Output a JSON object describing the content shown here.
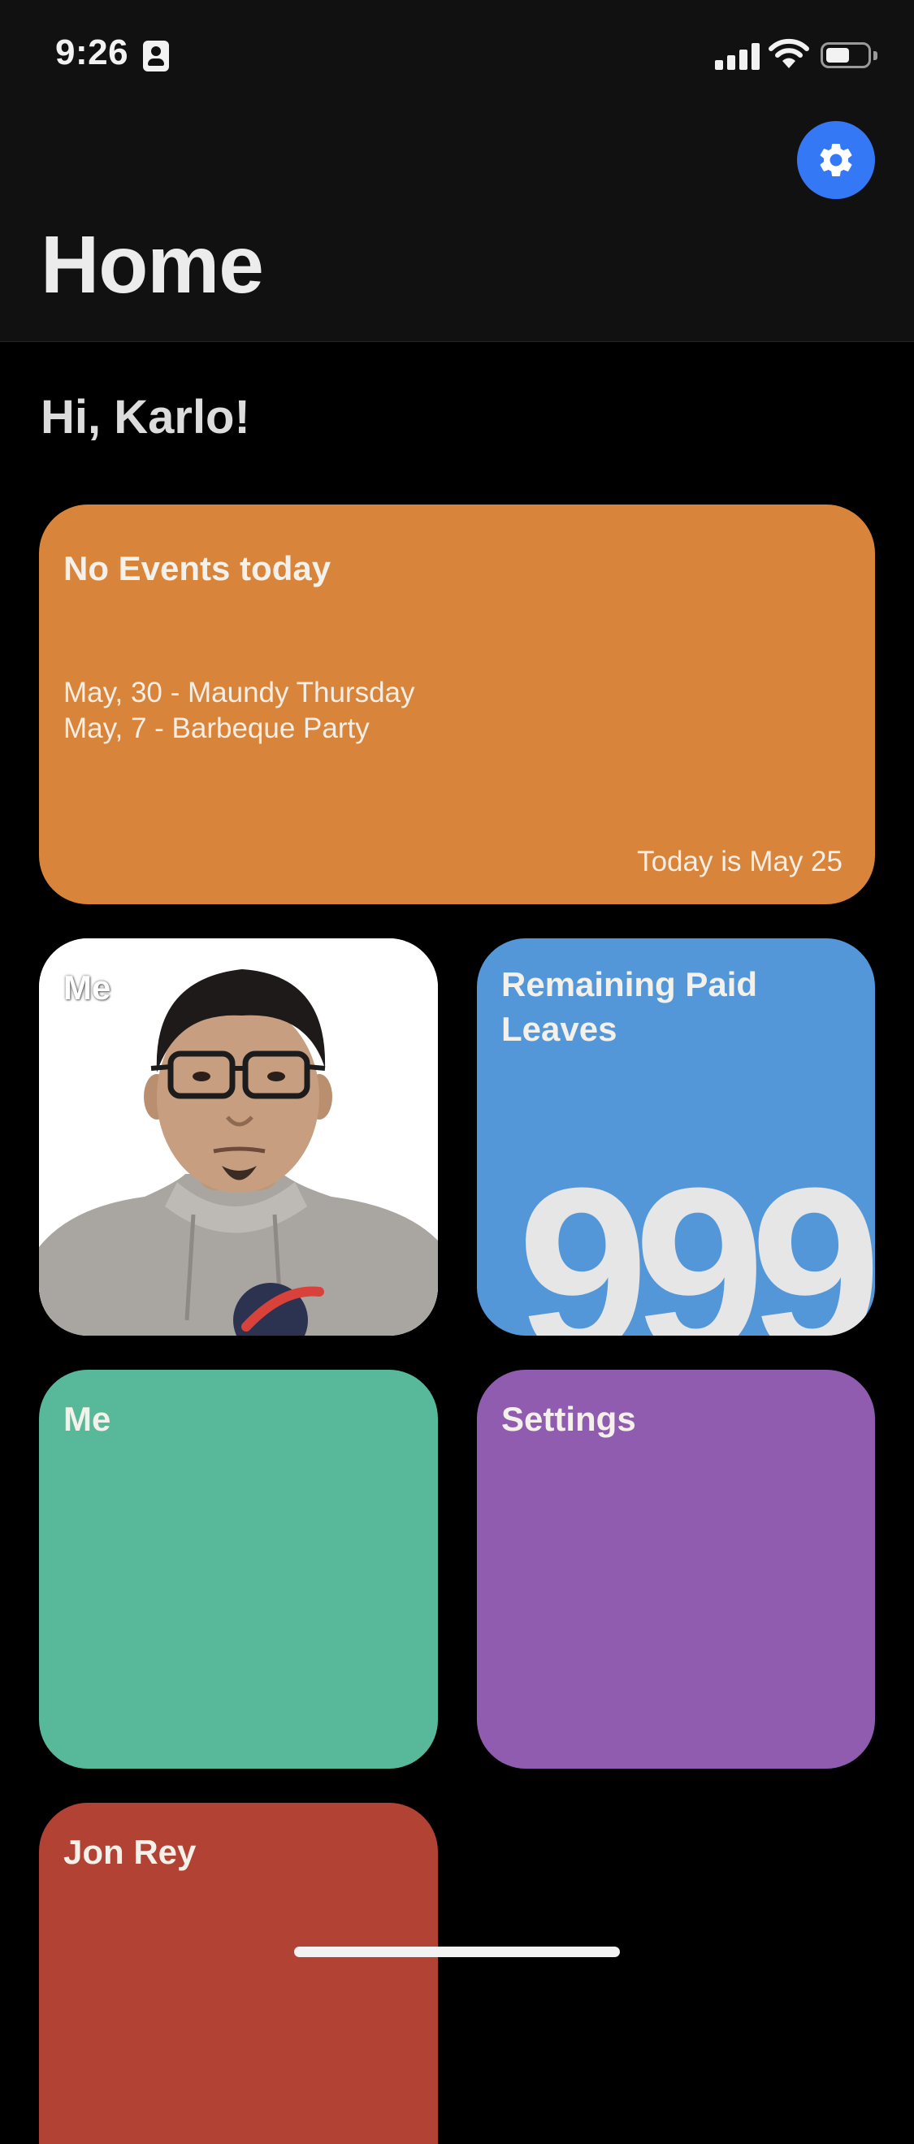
{
  "status_bar": {
    "time": "9:26"
  },
  "nav": {
    "title": "Home",
    "settings_icon": "gear-icon"
  },
  "greeting": "Hi, Karlo!",
  "tiles": {
    "events": {
      "title": "No Events today",
      "items": [
        "May, 30 - Maundy Thursday",
        "May, 7 - Barbeque Party"
      ],
      "today": "Today is May 25",
      "color": "#d8843b"
    },
    "photo": {
      "title": "Me",
      "color": "#ffffff"
    },
    "leaves": {
      "title": "Remaining Paid Leaves",
      "count": "999",
      "color": "#5497d9"
    },
    "me": {
      "title": "Me",
      "color": "#58b89a"
    },
    "settings": {
      "title": "Settings",
      "color": "#905cb0"
    },
    "jon": {
      "title": "Jon Rey",
      "color": "#b24334"
    }
  },
  "accent_color": "#3478f6"
}
